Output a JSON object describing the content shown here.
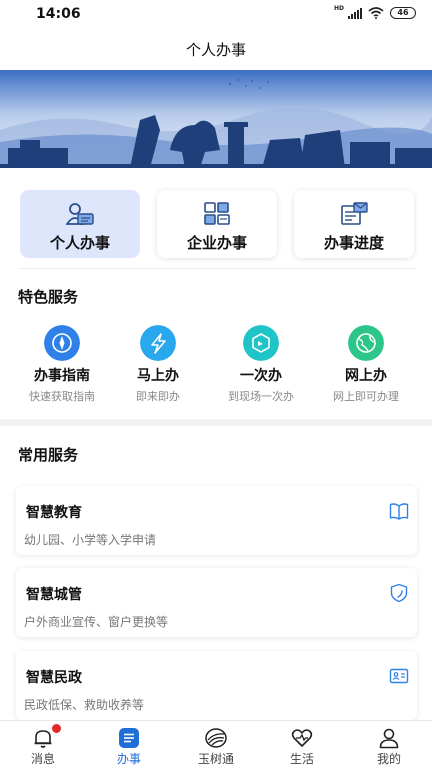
{
  "status": {
    "time": "14:06",
    "network": "HD",
    "battery": "46"
  },
  "header": {
    "title": "个人办事"
  },
  "quick_actions": [
    {
      "label": "个人办事",
      "active": true
    },
    {
      "label": "企业办事",
      "active": false
    },
    {
      "label": "办事进度",
      "active": false
    }
  ],
  "featured": {
    "title": "特色服务",
    "items": [
      {
        "name": "办事指南",
        "desc": "快速获取指南",
        "color": "#2f80e8",
        "icon": "compass-icon"
      },
      {
        "name": "马上办",
        "desc": "即来即办",
        "color": "#2aa8ee",
        "icon": "lightning-icon"
      },
      {
        "name": "一次办",
        "desc": "到现场一次办",
        "color": "#1ec4c8",
        "icon": "hexagon-icon"
      },
      {
        "name": "网上办",
        "desc": "网上即可办理",
        "color": "#2cc58a",
        "icon": "globe-icon"
      }
    ]
  },
  "common": {
    "title": "常用服务",
    "items": [
      {
        "title": "智慧教育",
        "desc": "幼儿园、小学等入学申请",
        "icon": "book-icon"
      },
      {
        "title": "智慧城管",
        "desc": "户外商业宣传、窗户更换等",
        "icon": "shield-icon"
      },
      {
        "title": "智慧民政",
        "desc": "民政低保、救助收养等",
        "icon": "id-card-icon"
      }
    ]
  },
  "tabbar": {
    "items": [
      {
        "label": "消息",
        "icon": "bell-icon",
        "badge": true
      },
      {
        "label": "办事",
        "icon": "document-icon",
        "active": true
      },
      {
        "label": "玉树通",
        "icon": "logo-icon"
      },
      {
        "label": "生活",
        "icon": "heart-icon"
      },
      {
        "label": "我的",
        "icon": "user-icon"
      }
    ]
  },
  "colors": {
    "accent": "#1e6fd6",
    "badge": "#e4272a",
    "card_active_bg": "#dde6fb"
  }
}
